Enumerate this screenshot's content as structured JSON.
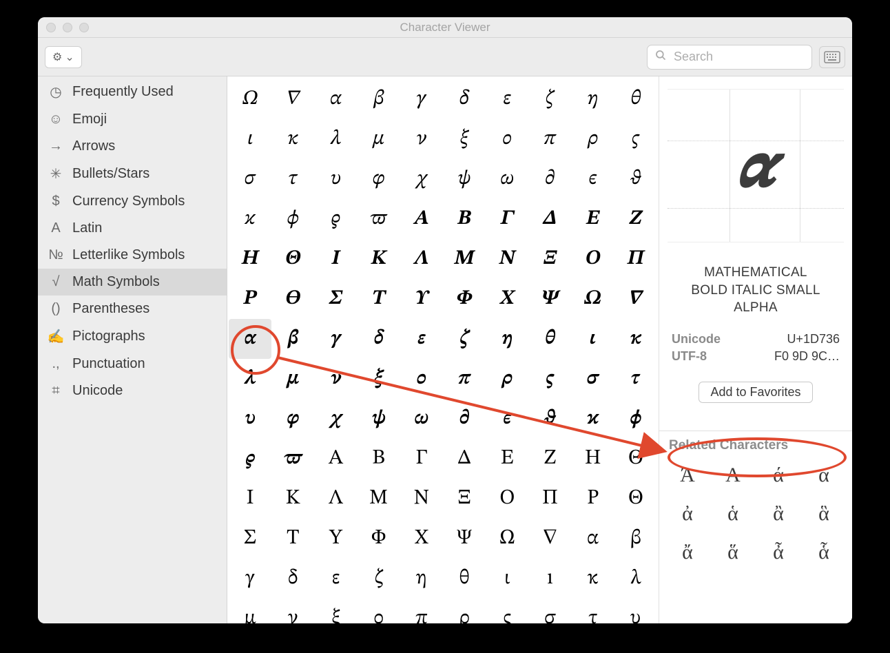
{
  "window": {
    "title": "Character Viewer"
  },
  "toolbar": {
    "search_placeholder": "Search"
  },
  "sidebar": {
    "items": [
      {
        "icon": "clock",
        "label": "Frequently Used"
      },
      {
        "icon": "emoji",
        "label": "Emoji"
      },
      {
        "icon": "arrow",
        "label": "Arrows"
      },
      {
        "icon": "bullets",
        "label": "Bullets/Stars"
      },
      {
        "icon": "currency",
        "label": "Currency Symbols"
      },
      {
        "icon": "latin",
        "label": "Latin"
      },
      {
        "icon": "numero",
        "label": "Letterlike Symbols"
      },
      {
        "icon": "radical",
        "label": "Math Symbols"
      },
      {
        "icon": "parens",
        "label": "Parentheses"
      },
      {
        "icon": "picto",
        "label": "Pictographs"
      },
      {
        "icon": "punct",
        "label": "Punctuation"
      },
      {
        "icon": "unicode",
        "label": "Unicode"
      }
    ],
    "selected_index": 7
  },
  "grid": {
    "cols": 10,
    "selected_index": 60,
    "chars": [
      "𝛺",
      "𝛻",
      "𝛼",
      "𝛽",
      "𝛾",
      "𝛿",
      "𝜀",
      "𝜁",
      "𝜂",
      "𝜃",
      "𝜄",
      "𝜅",
      "𝜆",
      "𝜇",
      "𝜈",
      "𝜉",
      "𝜊",
      "𝜋",
      "𝜌",
      "𝜍",
      "𝜎",
      "𝜏",
      "𝜐",
      "𝜑",
      "𝜒",
      "𝜓",
      "𝜔",
      "𝜕",
      "𝜖",
      "𝜗",
      "𝜘",
      "𝜙",
      "𝜚",
      "𝜛",
      "𝜜",
      "𝜝",
      "𝜞",
      "𝜟",
      "𝜠",
      "𝜡",
      "𝜢",
      "𝜣",
      "𝜤",
      "𝜥",
      "𝜦",
      "𝜧",
      "𝜨",
      "𝜩",
      "𝜪",
      "𝜫",
      "𝜬",
      "𝜭",
      "𝜮",
      "𝜯",
      "𝜰",
      "𝜱",
      "𝜲",
      "𝜳",
      "𝜴",
      "𝜵",
      "𝜶",
      "𝜷",
      "𝜸",
      "𝜹",
      "𝜺",
      "𝜻",
      "𝜼",
      "𝜽",
      "𝜾",
      "𝜿",
      "𝝀",
      "𝝁",
      "𝝂",
      "𝝃",
      "𝝄",
      "𝝅",
      "𝝆",
      "𝝇",
      "𝝈",
      "𝝉",
      "𝝊",
      "𝝋",
      "𝝌",
      "𝝍",
      "𝝎",
      "𝝏",
      "𝝐",
      "𝝑",
      "𝝒",
      "𝝓",
      "𝝔",
      "𝝕",
      "Α",
      "Β",
      "Γ",
      "Δ",
      "Ε",
      "Ζ",
      "Η",
      "Θ",
      "Ι",
      "Κ",
      "Λ",
      "Μ",
      "Ν",
      "Ξ",
      "Ο",
      "Π",
      "Ρ",
      "Θ",
      "Σ",
      "Τ",
      "Υ",
      "Φ",
      "Χ",
      "Ψ",
      "Ω",
      "∇",
      "α",
      "β",
      "γ",
      "δ",
      "ε",
      "ζ",
      "η",
      "θ",
      "ι",
      "ı",
      "κ",
      "λ",
      "μ",
      "ν",
      "ξ",
      "ο",
      "π",
      "ρ",
      "ς",
      "σ",
      "τ",
      "υ"
    ]
  },
  "detail": {
    "glyph": "𝜶",
    "name_lines": [
      "MATHEMATICAL",
      "BOLD ITALIC SMALL",
      "ALPHA"
    ],
    "unicode_label": "Unicode",
    "unicode_value": "U+1D736",
    "utf8_label": "UTF-8",
    "utf8_value": "F0 9D 9C…",
    "favorites_label": "Add to Favorites",
    "related_header": "Related Characters",
    "related": [
      "Ά",
      "Α",
      "ά",
      "α",
      "ἀ",
      "ἁ",
      "ἂ",
      "ἃ",
      "ἄ",
      "ἅ",
      "ἆ",
      "ἇ"
    ]
  },
  "icons": {
    "clock": "◷",
    "emoji": "☺",
    "arrow": "→",
    "bullets": "✳",
    "currency": "$",
    "latin": "A",
    "numero": "№",
    "radical": "√",
    "parens": "()",
    "picto": "✍",
    "punct": ".,",
    "unicode": "⌗",
    "gear": "⚙",
    "chevron": "⌄",
    "search": "🔍",
    "keyboard": "⌨"
  }
}
